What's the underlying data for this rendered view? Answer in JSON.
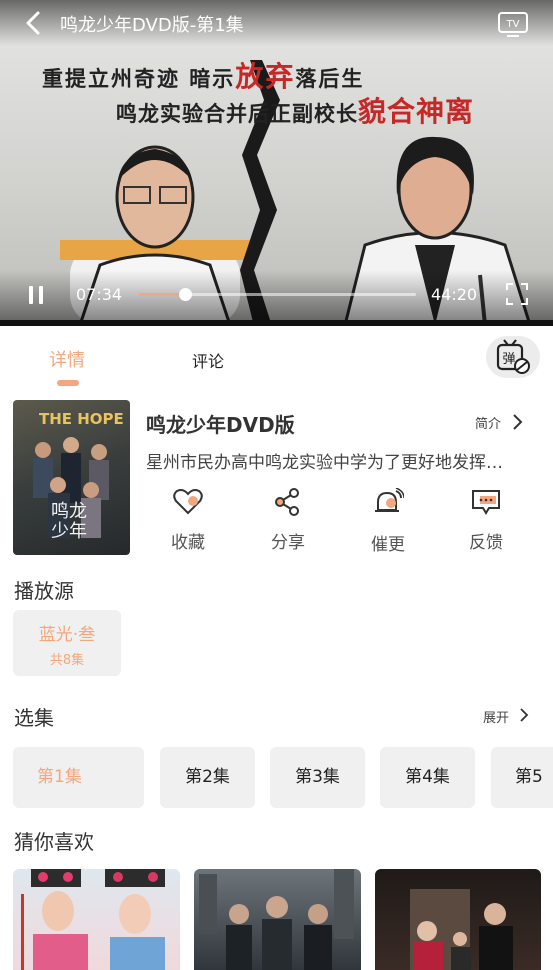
{
  "player": {
    "title": "鸣龙少年DVD版-第1集",
    "caption_line1_a": "重提立州奇迹  暗示",
    "caption_line1_red": "放弃",
    "caption_line1_b": "落后生",
    "caption_line2_a": "鸣龙实验合并后正副校长",
    "caption_line2_red": "貌合神离",
    "current_time": "07:34",
    "total_time": "44:20",
    "progress": 0.17
  },
  "tabs": {
    "details": "详情",
    "comments": "评论"
  },
  "danmu_icon_char": "弹",
  "show": {
    "title": "鸣龙少年DVD版",
    "intro_label": "简介",
    "description": "星州市民办高中鸣龙实验中学为了更好地发挥…",
    "poster_text": "THE HOPE",
    "poster_title": "鸣龙少年"
  },
  "actions": [
    {
      "label": "收藏",
      "icon": "heart-icon"
    },
    {
      "label": "分享",
      "icon": "share-icon"
    },
    {
      "label": "催更",
      "icon": "bell-icon"
    },
    {
      "label": "反馈",
      "icon": "feedback-icon"
    }
  ],
  "source_section": {
    "title": "播放源",
    "name": "蓝光·叁",
    "count": "共8集"
  },
  "episodes_section": {
    "title": "选集",
    "expand": "展开"
  },
  "episodes": [
    "第1集",
    "第2集",
    "第3集",
    "第4集",
    "第5"
  ],
  "recommend_section": {
    "title": "猜你喜欢"
  },
  "colors": {
    "accent": "#f4a77e",
    "chip_bg": "#f0f0f0"
  }
}
